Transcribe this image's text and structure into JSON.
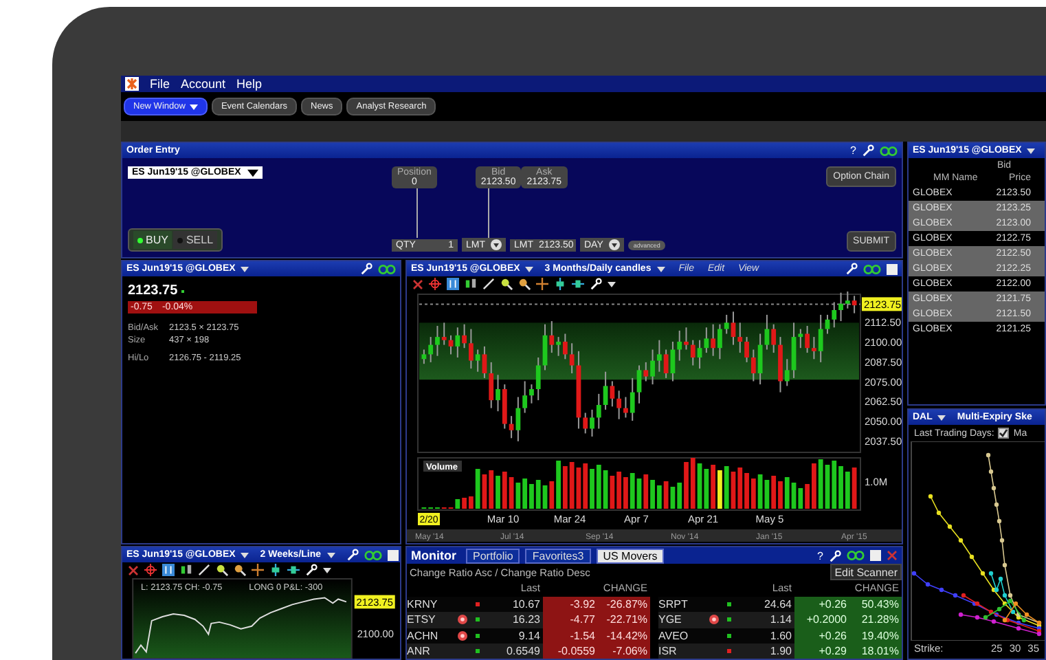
{
  "menu_bar": {
    "items": [
      "File",
      "Account",
      "Help"
    ]
  },
  "toolbar": {
    "buttons": [
      {
        "label": "New Window",
        "selected": true,
        "dropdown": true
      },
      {
        "label": "Event Calendars",
        "selected": false,
        "dropdown": false
      },
      {
        "label": "News",
        "selected": false,
        "dropdown": false
      },
      {
        "label": "Analyst Research",
        "selected": false,
        "dropdown": false
      }
    ]
  },
  "order_entry": {
    "title": "Order Entry",
    "help": "?",
    "contract": "ES Jun19'15 @GLOBEX",
    "position": {
      "label": "Position",
      "value": "0"
    },
    "bid": {
      "label": "Bid",
      "value": "2123.50"
    },
    "ask": {
      "label": "Ask",
      "value": "2123.75"
    },
    "option_chain": "Option Chain",
    "sides": [
      {
        "label": "BUY",
        "selected": true
      },
      {
        "label": "SELL",
        "selected": false
      }
    ],
    "qty": {
      "label": "QTY",
      "value": "1"
    },
    "order_type": "LMT",
    "price": {
      "label": "LMT",
      "value": "2123.50"
    },
    "tif": "DAY",
    "advanced": "advanced",
    "submit": "SUBMIT"
  },
  "market_depth": {
    "title": "ES Jun19'15 @GLOBEX",
    "side": "Bid",
    "columns": [
      "MM Name",
      "Price"
    ],
    "rows": [
      {
        "name": "GLOBEX",
        "price": "2123.50",
        "highlighted": false
      },
      {
        "name": "GLOBEX",
        "price": "2123.25",
        "highlighted": true
      },
      {
        "name": "GLOBEX",
        "price": "2123.00",
        "highlighted": true
      },
      {
        "name": "GLOBEX",
        "price": "2122.75",
        "highlighted": false
      },
      {
        "name": "GLOBEX",
        "price": "2122.50",
        "highlighted": true
      },
      {
        "name": "GLOBEX",
        "price": "2122.25",
        "highlighted": true
      },
      {
        "name": "GLOBEX",
        "price": "2122.00",
        "highlighted": false
      },
      {
        "name": "GLOBEX",
        "price": "2121.75",
        "highlighted": true
      },
      {
        "name": "GLOBEX",
        "price": "2121.50",
        "highlighted": true
      },
      {
        "name": "GLOBEX",
        "price": "2121.25",
        "highlighted": false
      }
    ]
  },
  "quote": {
    "title": "ES Jun19'15 @GLOBEX",
    "last": "2123.75",
    "change": "-0.75",
    "change_pct": "-0.04%",
    "fields": [
      {
        "label": "Bid/Ask",
        "value": "2123.5 × 2123.75"
      },
      {
        "label": "Size",
        "value": "437 × 198"
      },
      {
        "label": "Hi/Lo",
        "value": "2126.75 - 2119.25"
      }
    ]
  },
  "price_chart": {
    "title": "ES Jun19'15 @GLOBEX",
    "period": "3 Months/Daily candles",
    "menu": [
      "File",
      "Edit",
      "View"
    ],
    "last_tag": "2123.75",
    "price_labels": [
      "2112.50",
      "2100.00",
      "2087.50",
      "2075.00",
      "2062.50",
      "2050.00",
      "2037.50"
    ],
    "volume_label": "Volume",
    "volume_tick": "1.0M",
    "start_tag": "2/20",
    "date_labels": [
      "Mar 10",
      "Mar 24",
      "Apr 7",
      "Apr 21",
      "May 5"
    ],
    "navigator_labels": [
      "May '14",
      "Jul '14",
      "Sep '14",
      "Nov '14",
      "Jan '15",
      "Apr '15"
    ]
  },
  "line_chart": {
    "title": "ES Jun19'15 @GLOBEX",
    "period": "2 Weeks/Line",
    "legend": [
      "L: 2123.75 CH: -0.75",
      "LONG 0 P&L: -300"
    ],
    "last_tag": "2123.75",
    "price_labels": [
      "2100.00"
    ]
  },
  "monitor": {
    "title": "Monitor",
    "tabs": [
      {
        "label": "Portfolio",
        "selected": false
      },
      {
        "label": "Favorites3",
        "selected": false
      },
      {
        "label": "US Movers",
        "selected": true
      }
    ],
    "help": "?",
    "edit_button": "Edit Scanner",
    "subtitle": "Change Ratio Asc / Change Ratio Desc",
    "groups": [
      {
        "negative": true,
        "columns": [
          "Last",
          "CHANGE"
        ],
        "rows": [
          {
            "symbol": "KRNY",
            "alert": false,
            "color": "#e02020",
            "last": "10.67",
            "change": "-3.92",
            "change_pct": "-26.87%"
          },
          {
            "symbol": "ETSY",
            "alert": true,
            "color": "#20c020",
            "last": "16.23",
            "change": "-4.77",
            "change_pct": "-22.71%"
          },
          {
            "symbol": "ACHN",
            "alert": true,
            "color": "#20c020",
            "last": "9.14",
            "change": "-1.54",
            "change_pct": "-14.42%"
          },
          {
            "symbol": "ANR",
            "alert": false,
            "color": "#20c020",
            "last": "0.6549",
            "change": "-0.0559",
            "change_pct": "-7.06%"
          }
        ]
      },
      {
        "negative": false,
        "columns": [
          "Last",
          "CHANGE"
        ],
        "rows": [
          {
            "symbol": "SRPT",
            "alert": false,
            "color": "#20c020",
            "last": "24.64",
            "change": "+0.26",
            "change_pct": "50.43%"
          },
          {
            "symbol": "YGE",
            "alert": true,
            "color": "#20c020",
            "last": "1.14",
            "change": "+0.2000",
            "change_pct": "21.28%"
          },
          {
            "symbol": "AVEO",
            "alert": false,
            "color": "#20c020",
            "last": "1.60",
            "change": "+0.26",
            "change_pct": "19.40%"
          },
          {
            "symbol": "ISR",
            "alert": false,
            "color": "#e02020",
            "last": "1.90",
            "change": "+0.29",
            "change_pct": "18.01%"
          }
        ]
      }
    ]
  },
  "skew": {
    "symbol": "DAL",
    "title": "Multi-Expiry Ske",
    "days_label": "Last Trading Days:",
    "expiry": {
      "label": "Ma",
      "checked": true
    },
    "strike_label": "Strike:",
    "strikes": [
      "25",
      "30",
      "35"
    ]
  }
}
